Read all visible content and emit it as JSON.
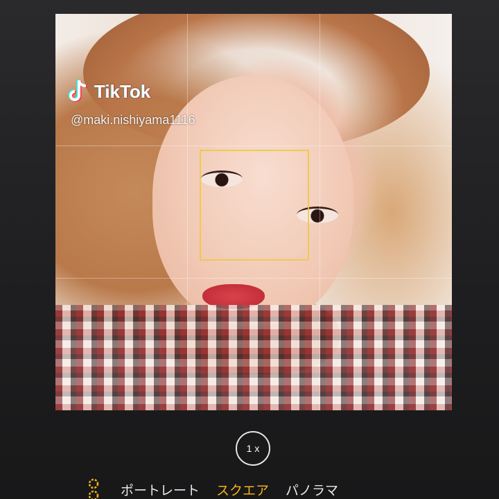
{
  "viewfinder": {
    "watermark": {
      "logo_icon": "tiktok-note-icon",
      "brand": "TikTok",
      "handle": "@maki.nishiyama1116"
    }
  },
  "controls": {
    "zoom_label": "1 x",
    "modes": [
      {
        "label": "ポートレート",
        "active": false
      },
      {
        "label": "スクエア",
        "active": true
      },
      {
        "label": "パノラマ",
        "active": false
      }
    ],
    "accent_color": "#f3b21a",
    "mode_icon": "live-photo-icon"
  }
}
